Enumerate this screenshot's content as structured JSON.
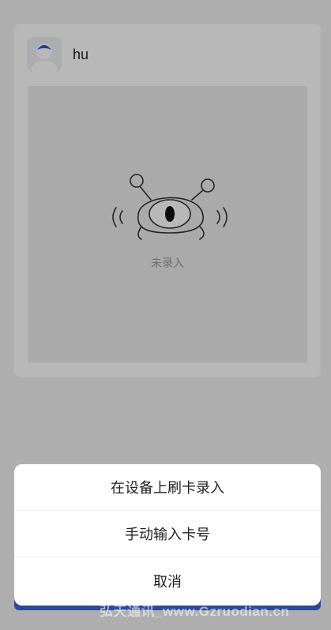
{
  "user": {
    "name": "hu",
    "avatar_icon": "user-avatar-icon"
  },
  "card": {
    "status_text": "未录入",
    "illustration_icon": "one-eyed-alien-icon"
  },
  "action_sheet": {
    "items": [
      {
        "label": "在设备上刷卡录入"
      },
      {
        "label": "手动输入卡号"
      },
      {
        "label": "取消"
      }
    ]
  },
  "watermark": "弘天通讯_www.Gzruodian.cn",
  "colors": {
    "accent": "#3a66d9",
    "overlay": "rgba(0,0,0,0.28)"
  }
}
